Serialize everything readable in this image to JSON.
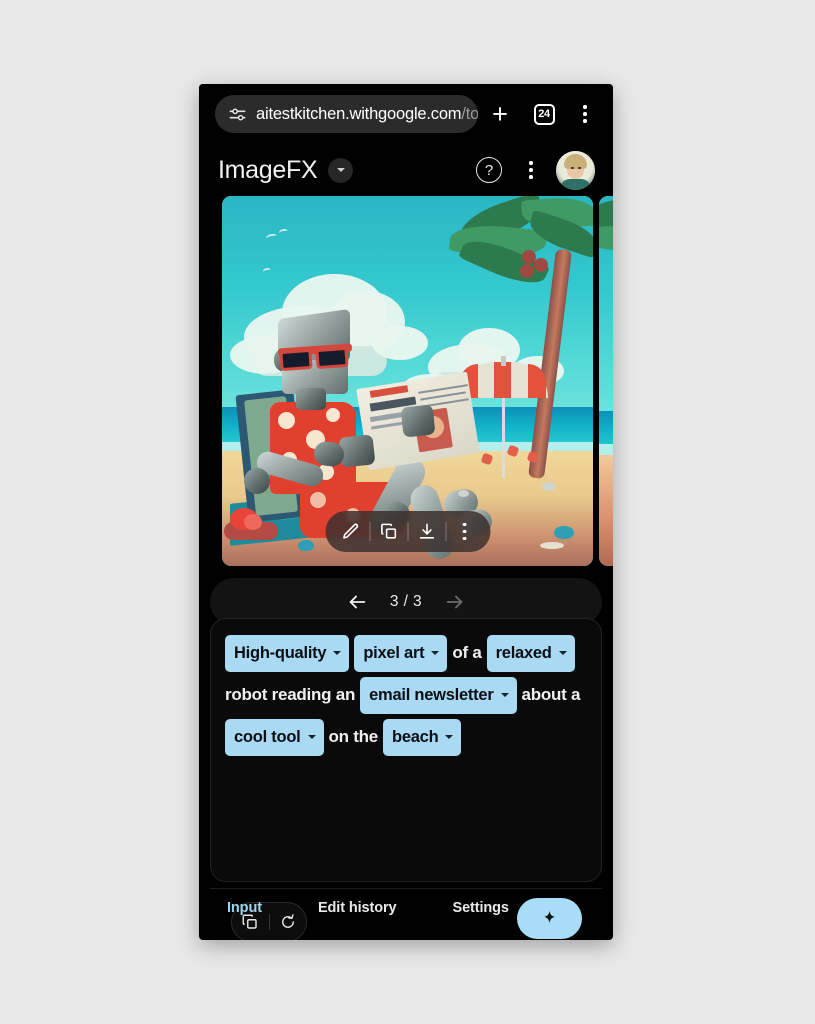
{
  "browser": {
    "site_info_icon": "tune-icon",
    "url_host": "aitestkitchen.withgoogle.com",
    "url_path": "/too",
    "new_tab_label": "+",
    "tab_count": "24",
    "menu_icon": "kebab-menu-icon"
  },
  "app": {
    "title": "ImageFX",
    "switcher_icon": "chevron-down-icon",
    "help_icon": "help-circle-icon",
    "help_glyph": "?",
    "menu_icon": "kebab-menu-icon",
    "avatar_icon": "user-avatar"
  },
  "image": {
    "alt": "Pixel-art illustration of a relaxed robot in a Hawaiian shirt reading a newspaper on a beach with a palm tree and a striped umbrella",
    "toolbar": [
      {
        "name": "edit-image-button",
        "icon": "pencil-icon"
      },
      {
        "name": "copy-image-button",
        "icon": "copy-icon"
      },
      {
        "name": "download-image-button",
        "icon": "download-icon"
      },
      {
        "name": "image-more-button",
        "icon": "kebab-menu-icon"
      }
    ]
  },
  "pagination": {
    "prev_icon": "arrow-left-icon",
    "label": "3 / 3",
    "next_icon": "arrow-right-icon",
    "current": 3,
    "total": 3
  },
  "prompt": {
    "tokens": [
      {
        "type": "chip",
        "text": "High-quality"
      },
      {
        "type": "chip",
        "text": "pixel art"
      },
      {
        "type": "plain",
        "text": "of a"
      },
      {
        "type": "chip",
        "text": "relaxed"
      },
      {
        "type": "plain",
        "text": "robot reading an"
      },
      {
        "type": "chip",
        "text": "email newsletter"
      },
      {
        "type": "plain",
        "text": "about a"
      },
      {
        "type": "chip",
        "text": "cool tool"
      },
      {
        "type": "plain",
        "text": "on the"
      },
      {
        "type": "chip",
        "text": "beach"
      }
    ]
  },
  "actions": {
    "copy_prompt_icon": "copy-icon",
    "reset_prompt_icon": "refresh-icon",
    "generate_icon": "sparkle-icon"
  },
  "tabs": [
    {
      "label": "Input",
      "active": true
    },
    {
      "label": "Edit history",
      "active": false
    },
    {
      "label": "Settings",
      "active": false
    }
  ],
  "colors": {
    "accent": "#9fd6ef",
    "chip_bg": "#a9d9f3",
    "generate_bg": "#a9ddf7",
    "app_bg": "#000000",
    "panel_bg": "#0a0a0a",
    "page_bg": "#e8e8e8"
  }
}
